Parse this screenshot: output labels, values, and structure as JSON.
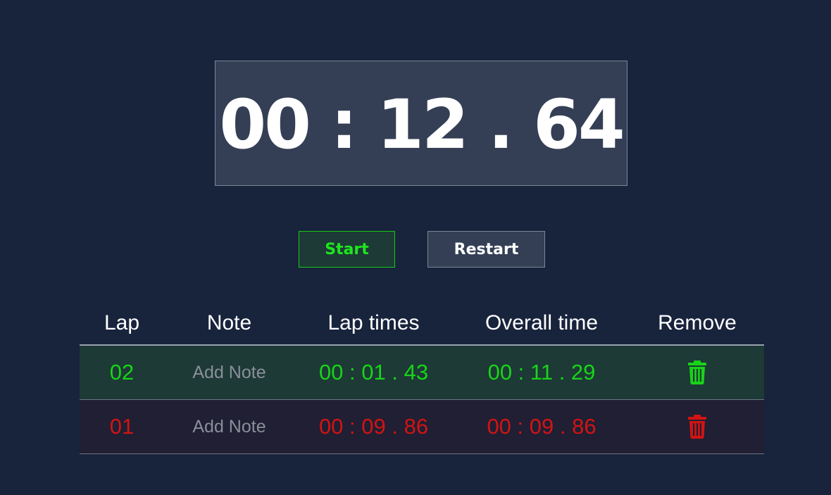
{
  "timer": {
    "display": "00 : 12 . 64"
  },
  "controls": {
    "start_label": "Start",
    "restart_label": "Restart"
  },
  "table": {
    "headers": {
      "lap": "Lap",
      "note": "Note",
      "lap_times": "Lap times",
      "overall_time": "Overall time",
      "remove": "Remove"
    },
    "rows": [
      {
        "lap": "02",
        "note_placeholder": "Add Note",
        "lap_time": "00 : 01 . 43",
        "overall_time": "00 : 11 . 29",
        "status": "green",
        "remove_icon": "trash-icon"
      },
      {
        "lap": "01",
        "note_placeholder": "Add Note",
        "lap_time": "00 : 09 . 86",
        "overall_time": "00 : 09 . 86",
        "status": "red",
        "remove_icon": "trash-icon"
      }
    ]
  },
  "colors": {
    "background": "#18233c",
    "panel": "#343f55",
    "accent_green": "#18d418",
    "accent_red": "#d31313"
  }
}
